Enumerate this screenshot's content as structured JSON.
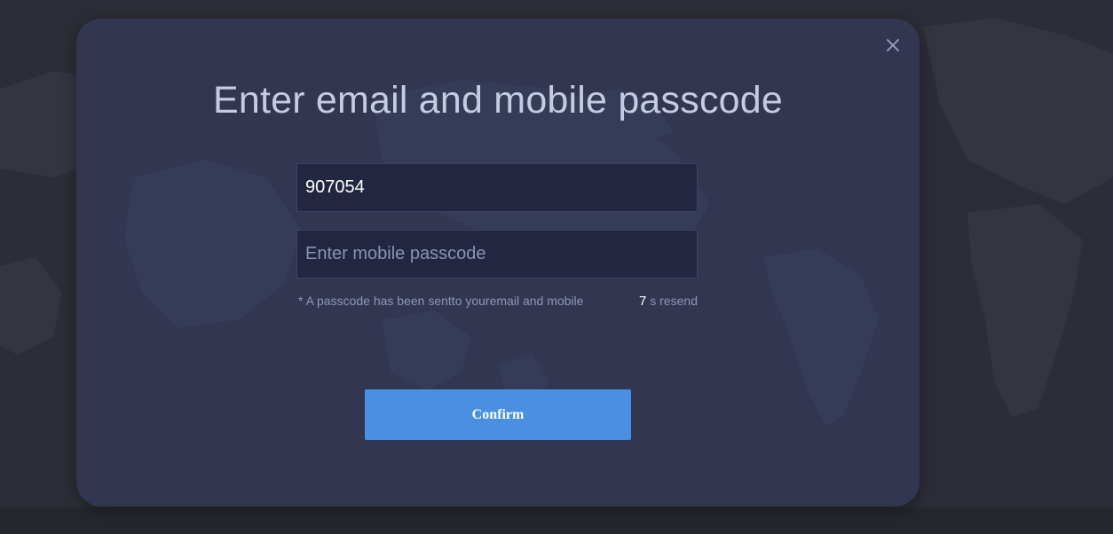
{
  "modal": {
    "title": "Enter email and mobile passcode",
    "close_icon": "close-icon",
    "email_passcode": {
      "value": "907054",
      "placeholder": ""
    },
    "mobile_passcode": {
      "value": "",
      "placeholder": "Enter mobile passcode"
    },
    "hint": "* A passcode has been sentto youremail and mobile",
    "resend": {
      "countdown": "7",
      "label": "s resend"
    },
    "confirm_label": "Confirm"
  },
  "colors": {
    "page_background": "#2c2d36",
    "modal_background": "#323650",
    "input_background": "#222641",
    "accent": "#4a90e2",
    "title_text": "#c5cbe0",
    "hint_text": "#8f97b3"
  }
}
